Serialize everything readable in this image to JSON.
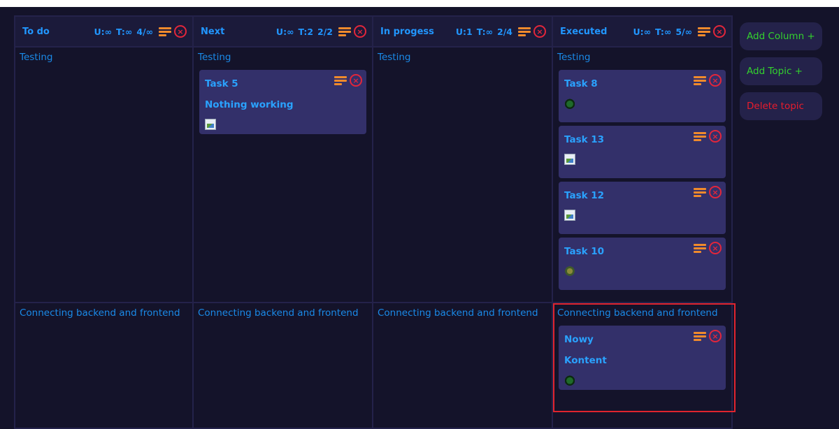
{
  "columns": [
    {
      "title": "To do",
      "limits": {
        "users": "U:∞",
        "tasks": "T:∞",
        "count": "4/∞"
      },
      "topics": [
        {
          "title": "Testing",
          "tasks": []
        },
        {
          "title": "Connecting backend and frontend",
          "tasks": []
        }
      ]
    },
    {
      "title": "Next",
      "limits": {
        "users": "U:∞",
        "tasks": "T:2",
        "count": "2/2"
      },
      "topics": [
        {
          "title": "Testing",
          "tasks": [
            {
              "title": "Task 5",
              "description": "Nothing working",
              "avatar": "broken-image"
            }
          ]
        },
        {
          "title": "Connecting backend and frontend",
          "tasks": []
        }
      ]
    },
    {
      "title": "In progess",
      "limits": {
        "users": "U:1",
        "tasks": "T:∞",
        "count": "2/4"
      },
      "topics": [
        {
          "title": "Testing",
          "tasks": []
        },
        {
          "title": "Connecting backend and frontend",
          "tasks": []
        }
      ]
    },
    {
      "title": "Executed",
      "limits": {
        "users": "U:∞",
        "tasks": "T:∞",
        "count": "5/∞"
      },
      "topics": [
        {
          "title": "Testing",
          "tasks": [
            {
              "title": "Task 8",
              "avatar": "tree-avatar"
            },
            {
              "title": "Task 13",
              "avatar": "broken-image"
            },
            {
              "title": "Task 12",
              "avatar": "broken-image"
            },
            {
              "title": "Task 10",
              "avatar": "moss-avatar"
            }
          ]
        },
        {
          "title": "Connecting backend and frontend",
          "tasks": [
            {
              "title": "Nowy",
              "description": "Kontent",
              "avatar": "tree-avatar"
            }
          ]
        }
      ]
    }
  ],
  "sidebar": {
    "add_column": "Add Column +",
    "add_topic": "Add Topic +",
    "delete_topic": "Delete topic"
  },
  "icons": {
    "menu": "menu-lines-icon",
    "close": "close-circle-icon",
    "close_glyph": "×"
  },
  "colors": {
    "accent": "#2196ff",
    "menu": "#f08a2c",
    "close": "#e2263b",
    "add": "#33d12e",
    "delete": "#e81c2c",
    "card": "#33306a",
    "background": "#14132a"
  }
}
